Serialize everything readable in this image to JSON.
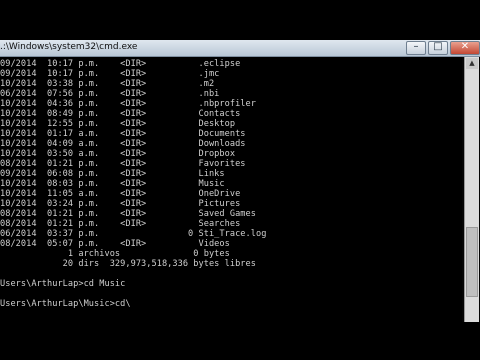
{
  "window": {
    "title": ".:\\Windows\\system32\\cmd.exe",
    "buttons": {
      "minimize": "–",
      "maximize": "□",
      "close": "✕"
    }
  },
  "console": {
    "lines": [
      "09/2014  10:17 p.m.    <DIR>          .eclipse",
      "09/2014  10:17 p.m.    <DIR>          .jmc",
      "10/2014  03:38 p.m.    <DIR>          .m2",
      "06/2014  07:56 p.m.    <DIR>          .nbi",
      "10/2014  04:36 p.m.    <DIR>          .nbprofiler",
      "10/2014  08:49 p.m.    <DIR>          Contacts",
      "10/2014  12:55 p.m.    <DIR>          Desktop",
      "10/2014  01:17 a.m.    <DIR>          Documents",
      "10/2014  04:09 a.m.    <DIR>          Downloads",
      "10/2014  03:50 a.m.    <DIR>          Dropbox",
      "08/2014  01:21 p.m.    <DIR>          Favorites",
      "09/2014  06:08 p.m.    <DIR>          Links",
      "10/2014  08:03 p.m.    <DIR>          Music",
      "10/2014  11:05 a.m.    <DIR>          OneDrive",
      "10/2014  03:24 p.m.    <DIR>          Pictures",
      "08/2014  01:21 p.m.    <DIR>          Saved Games",
      "08/2014  01:21 p.m.    <DIR>          Searches",
      "06/2014  03:37 p.m.                 0 Sti_Trace.log",
      "08/2014  05:07 p.m.    <DIR>          Videos",
      "             1 archivos              0 bytes",
      "            20 dirs  329,973,518,336 bytes libres",
      "",
      "Users\\ArthurLap>cd Music",
      "",
      "Users\\ArthurLap\\Music>cd\\"
    ]
  }
}
